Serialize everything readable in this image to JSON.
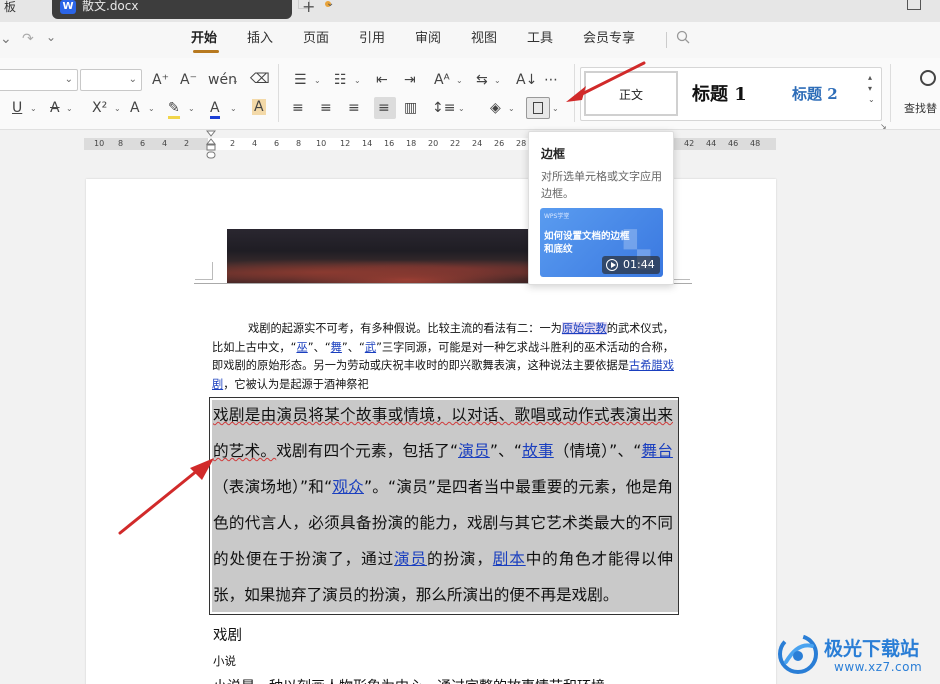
{
  "titlebar": {
    "prev_tab_label": "板",
    "doc_tab_name": "散文.docx",
    "app_logo_letter": "W"
  },
  "menu": {
    "tabs": [
      {
        "label": "开始",
        "active": true
      },
      {
        "label": "插入"
      },
      {
        "label": "页面"
      },
      {
        "label": "引用"
      },
      {
        "label": "审阅"
      },
      {
        "label": "视图"
      },
      {
        "label": "工具"
      },
      {
        "label": "会员专享"
      }
    ]
  },
  "ribbon": {
    "styles": {
      "normal": "正文",
      "h1": "标题  1",
      "h2": "标题  2"
    },
    "find_label": "查找替",
    "accent_color": "#b7791f"
  },
  "ruler": {
    "left_numbers": [
      "10",
      "8",
      "6",
      "4",
      "2"
    ],
    "right_numbers": [
      "2",
      "4",
      "6",
      "8",
      "10",
      "12",
      "14",
      "16",
      "18",
      "20",
      "22",
      "24",
      "26",
      "28"
    ],
    "far_numbers": [
      "42",
      "44",
      "46",
      "48"
    ]
  },
  "tooltip": {
    "title": "边框",
    "description": "对所选单元格或文字应用边框。",
    "thumb_brand": "WPS学堂",
    "thumb_caption": "如何设置文档的边框和底纹",
    "duration": "01:44"
  },
  "document": {
    "para1": {
      "t1": "戏剧的起源实不可考，有多种假说。比较主流的看法有二：一为",
      "l1": "原始宗教",
      "t2": "的武术仪式，比如上古中文，“",
      "l2": "巫",
      "t3": "”、“",
      "l3": "舞",
      "t4": "”、“",
      "l4": "武",
      "t5": "”三字同源，可能是对一种乞求战斗胜利的巫术活动的合称，即戏剧的原始形态。另一为劳动或庆祝丰收时的即兴歌舞表演，这种说法主要依据是",
      "l5": "古希腊戏剧",
      "t6": "，它被认为是起源于酒神祭祀"
    },
    "para2": {
      "t1": "戏剧是由演员将某个故事或情境，以对话、歌唱或动作式表演出来的艺术。",
      "t2": "戏剧有四个元素，包括了“",
      "l1": "演员",
      "t3": "”、“",
      "l2": "故事",
      "t4": "（情境）”、“",
      "l3": "舞台",
      "t5": "（表演场地）”和“",
      "l4": "观众",
      "t6": "”。“演员”是四者当中最重要的元素，他是角色的代言人，必须具备扮演的能力，戏剧与其它艺术类最大的不同的处便在于扮演了，通过",
      "l5": "演员",
      "t7": "的扮演，",
      "l6": "剧本",
      "t8": "中的角色才能得以伸张，如果抛弃了演员的扮演，那么所演出的便不再是戏剧。"
    },
    "heading_drama": "戏剧",
    "heading_novel": "小说",
    "cut_line": "小说是一种以刻画人物形象为中心，通过完整的故事情节和环境"
  },
  "watermark": {
    "name": "极光下载站",
    "url": "www.xz7.com"
  }
}
